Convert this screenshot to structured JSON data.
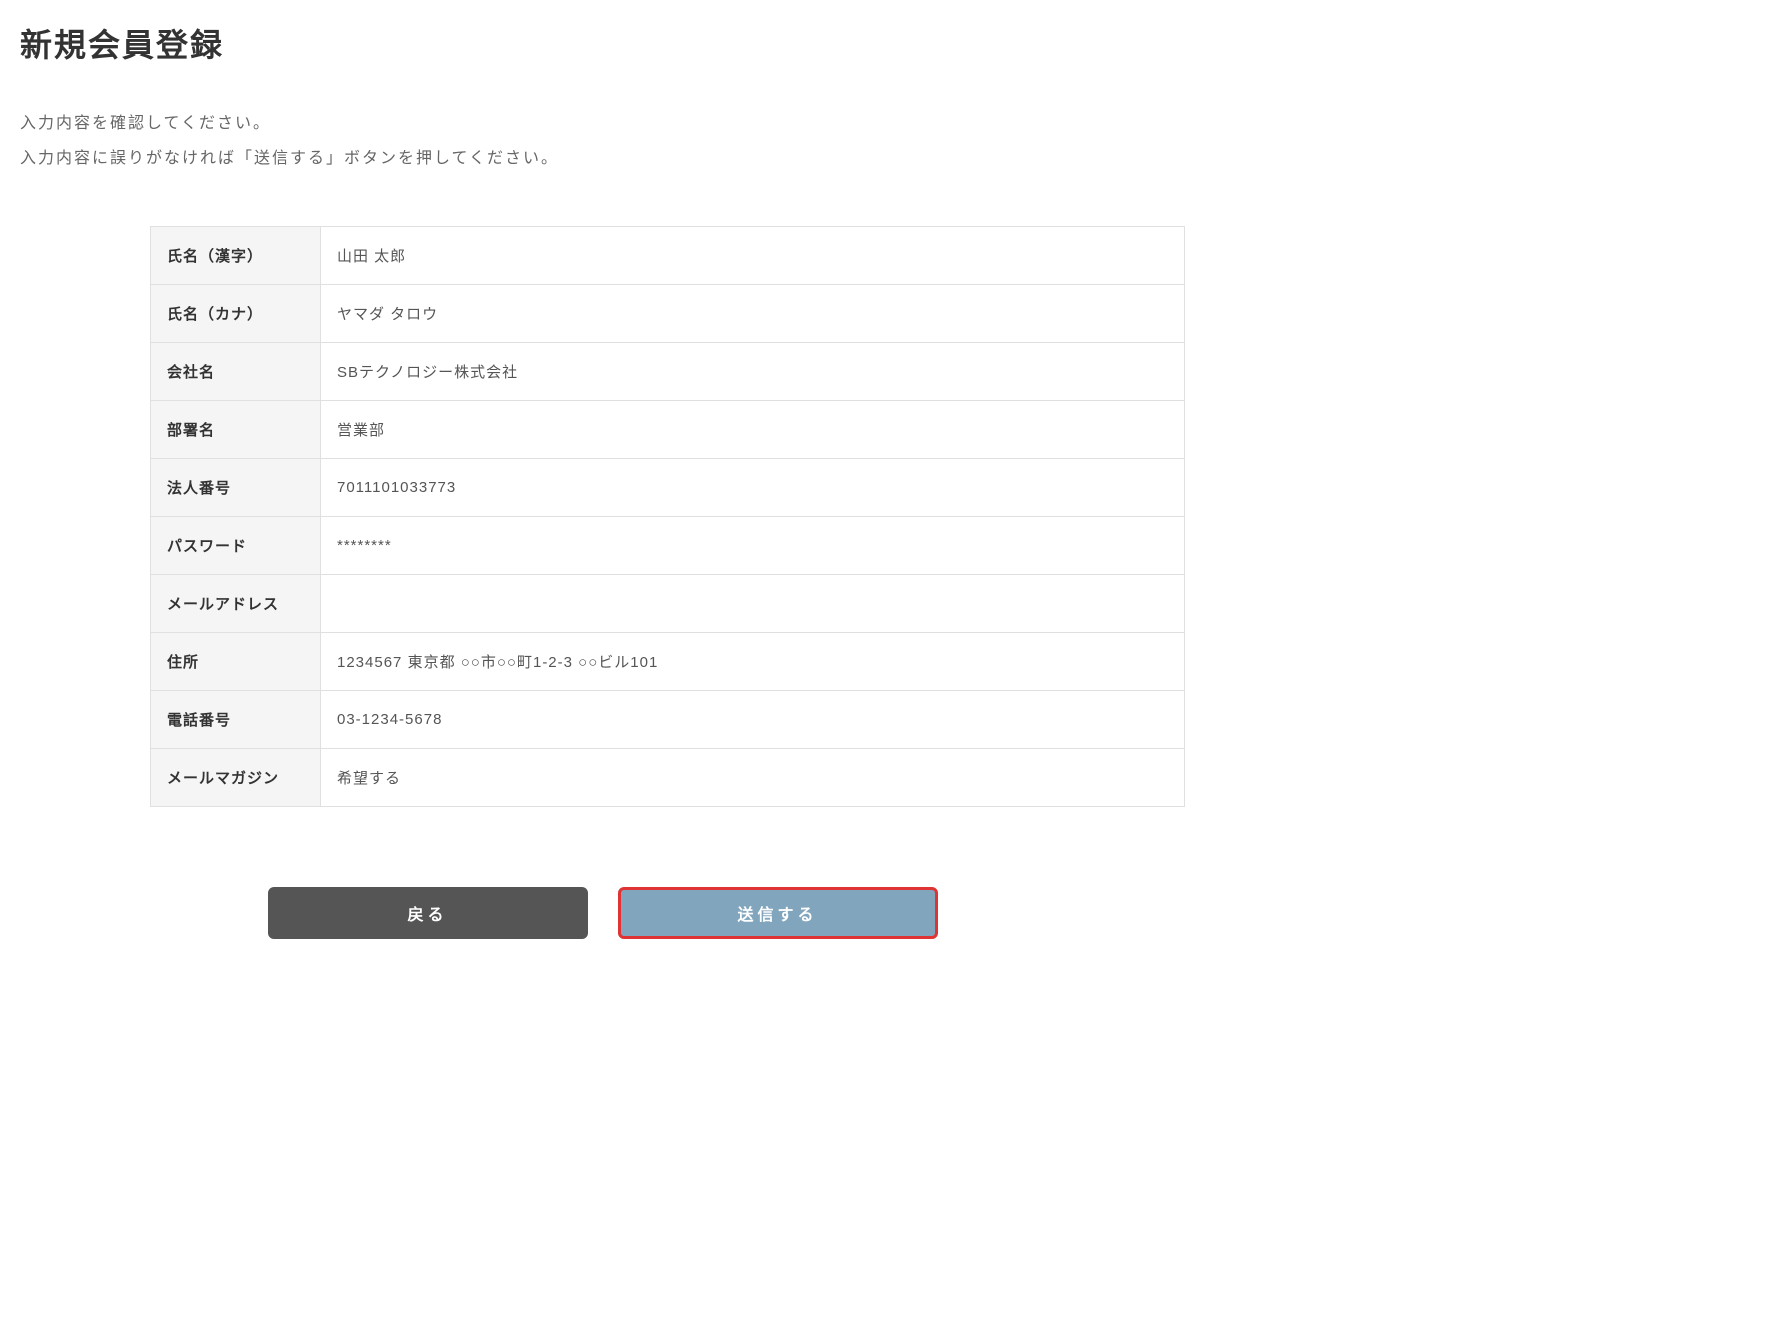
{
  "page": {
    "title": "新規会員登録",
    "instruction1": "入力内容を確認してください。",
    "instruction2": "入力内容に誤りがなければ「送信する」ボタンを押してください。"
  },
  "fields": {
    "name_kanji": {
      "label": "氏名（漢字）",
      "value": "山田 太郎"
    },
    "name_kana": {
      "label": "氏名（カナ）",
      "value": "ヤマダ タロウ"
    },
    "company": {
      "label": "会社名",
      "value": "SBテクノロジー株式会社"
    },
    "department": {
      "label": "部署名",
      "value": "営業部"
    },
    "corporate_number": {
      "label": "法人番号",
      "value": "7011101033773"
    },
    "password": {
      "label": "パスワード",
      "value": "********"
    },
    "email": {
      "label": "メールアドレス",
      "value": ""
    },
    "address": {
      "label": "住所",
      "value": "1234567 東京都 ○○市○○町1-2-3 ○○ビル101"
    },
    "phone": {
      "label": "電話番号",
      "value": "03-1234-5678"
    },
    "mailmagazine": {
      "label": "メールマガジン",
      "value": "希望する"
    }
  },
  "buttons": {
    "back": "戻る",
    "submit": "送信する"
  }
}
